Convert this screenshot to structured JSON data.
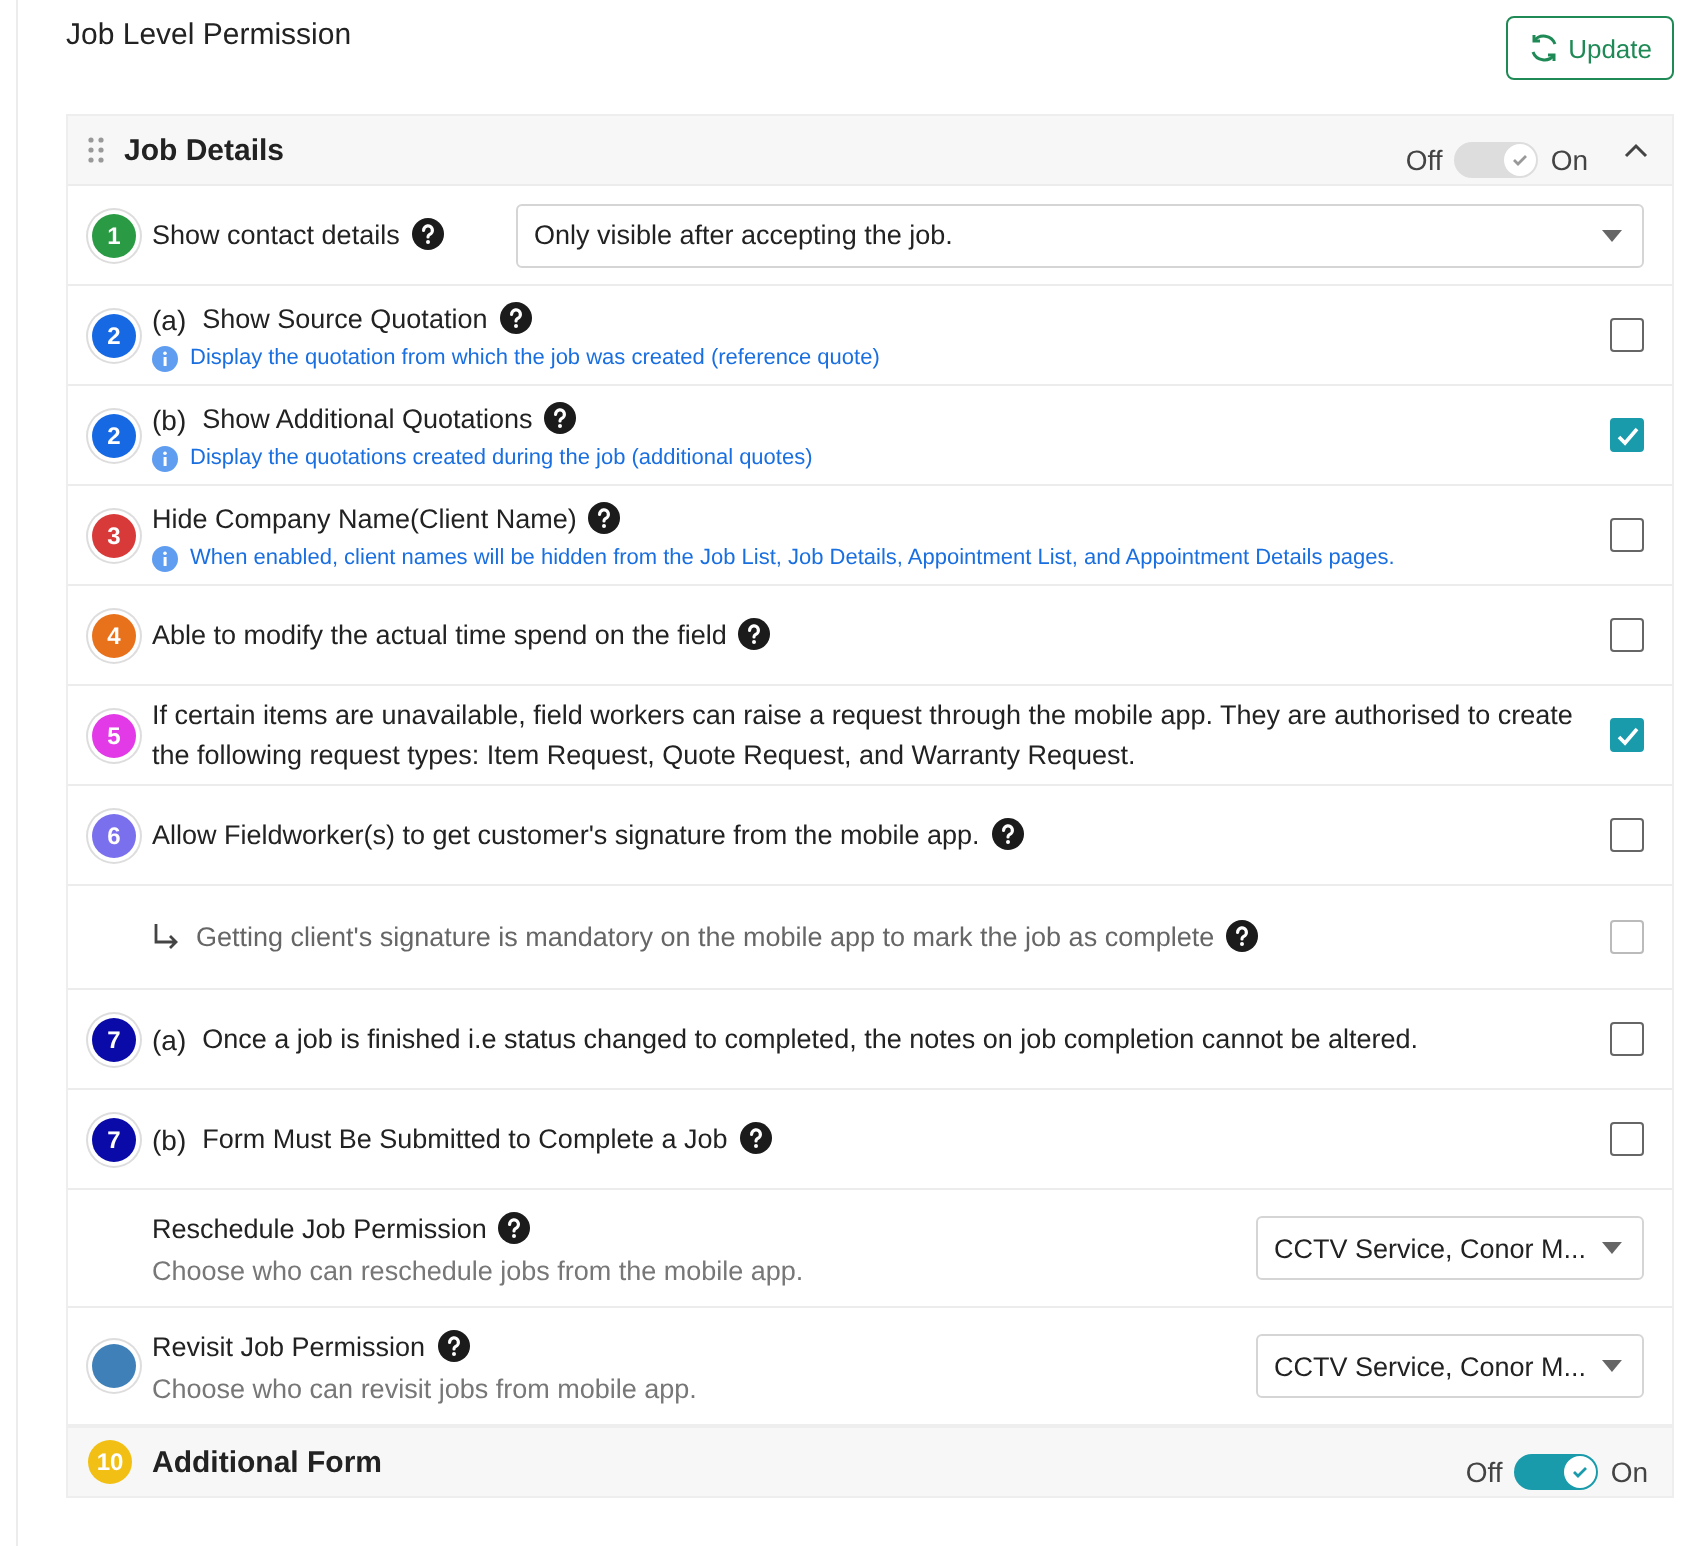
{
  "page_title": "Job Level Permission",
  "update_button": {
    "label": "Update"
  },
  "sections": [
    {
      "title": "Job Details",
      "toggle": {
        "off_label": "Off",
        "on_label": "On",
        "on": true,
        "disabled": true
      },
      "expanded": true,
      "rows": [
        {
          "kind": "select",
          "badge": "1",
          "color": "#2b9a45",
          "label": "Show contact details",
          "help": true,
          "value": "Only visible after accepting the job."
        },
        {
          "kind": "checkbox",
          "badge": "2",
          "color": "#1668e3",
          "prefix": "(a)",
          "label": "Show Source Quotation",
          "help": true,
          "note": "Display the quotation from which the job was created (reference quote)",
          "checked": false
        },
        {
          "kind": "checkbox",
          "badge": "2",
          "color": "#1668e3",
          "prefix": "(b)",
          "label": "Show Additional Quotations",
          "help": true,
          "note": "Display the quotations created during the job (additional quotes)",
          "checked": true
        },
        {
          "kind": "checkbox",
          "badge": "3",
          "color": "#d83a3a",
          "label": "Hide Company Name(Client Name)",
          "help": true,
          "note": "When enabled, client names will be hidden from the Job List, Job Details, Appointment List, and Appointment Details pages.",
          "checked": false
        },
        {
          "kind": "checkbox",
          "badge": "4",
          "color": "#e8721c",
          "label": "Able to modify the actual time spend on the field",
          "help": true,
          "checked": false
        },
        {
          "kind": "checkbox",
          "badge": "5",
          "color": "#e23ae6",
          "label": "If certain items are unavailable, field workers can raise a request through the mobile app. They are authorised to create the following request types: Item Request, Quote Request, and Warranty Request.",
          "help": false,
          "checked": true
        },
        {
          "kind": "checkbox",
          "badge": "6",
          "color": "#7a70ee",
          "label": "Allow Fieldworker(s) to get customer's signature from the mobile app.",
          "help": true,
          "checked": false
        },
        {
          "kind": "sub_checkbox",
          "label": "Getting client's signature is mandatory on the mobile app to mark the job as complete",
          "help": true,
          "checked": false,
          "disabled": true
        },
        {
          "kind": "checkbox",
          "badge": "7",
          "color": "#0a0aa8",
          "prefix": "(a)",
          "label": "Once a job is finished i.e status changed to completed, the notes on job completion cannot be altered.",
          "help": false,
          "checked": false
        },
        {
          "kind": "checkbox",
          "badge": "7",
          "color": "#0a0aa8",
          "prefix": "(b)",
          "label": "Form Must Be Submitted to Complete a Job",
          "help": true,
          "checked": false
        },
        {
          "kind": "permission",
          "label": "Reschedule Job Permission",
          "help": true,
          "note": "Choose who can reschedule jobs from the mobile app.",
          "value": "CCTV Service, Conor M..."
        },
        {
          "kind": "permission",
          "badge_partial": true,
          "color": "#3f80b8",
          "label": "Revisit Job Permission",
          "help": true,
          "note": "Choose who can revisit jobs from mobile app.",
          "value": "CCTV Service, Conor M..."
        }
      ]
    },
    {
      "title": "Additional Form",
      "badge": "10",
      "color": "#f2c014",
      "toggle": {
        "off_label": "Off",
        "on_label": "On",
        "on": true,
        "disabled": false
      }
    }
  ]
}
